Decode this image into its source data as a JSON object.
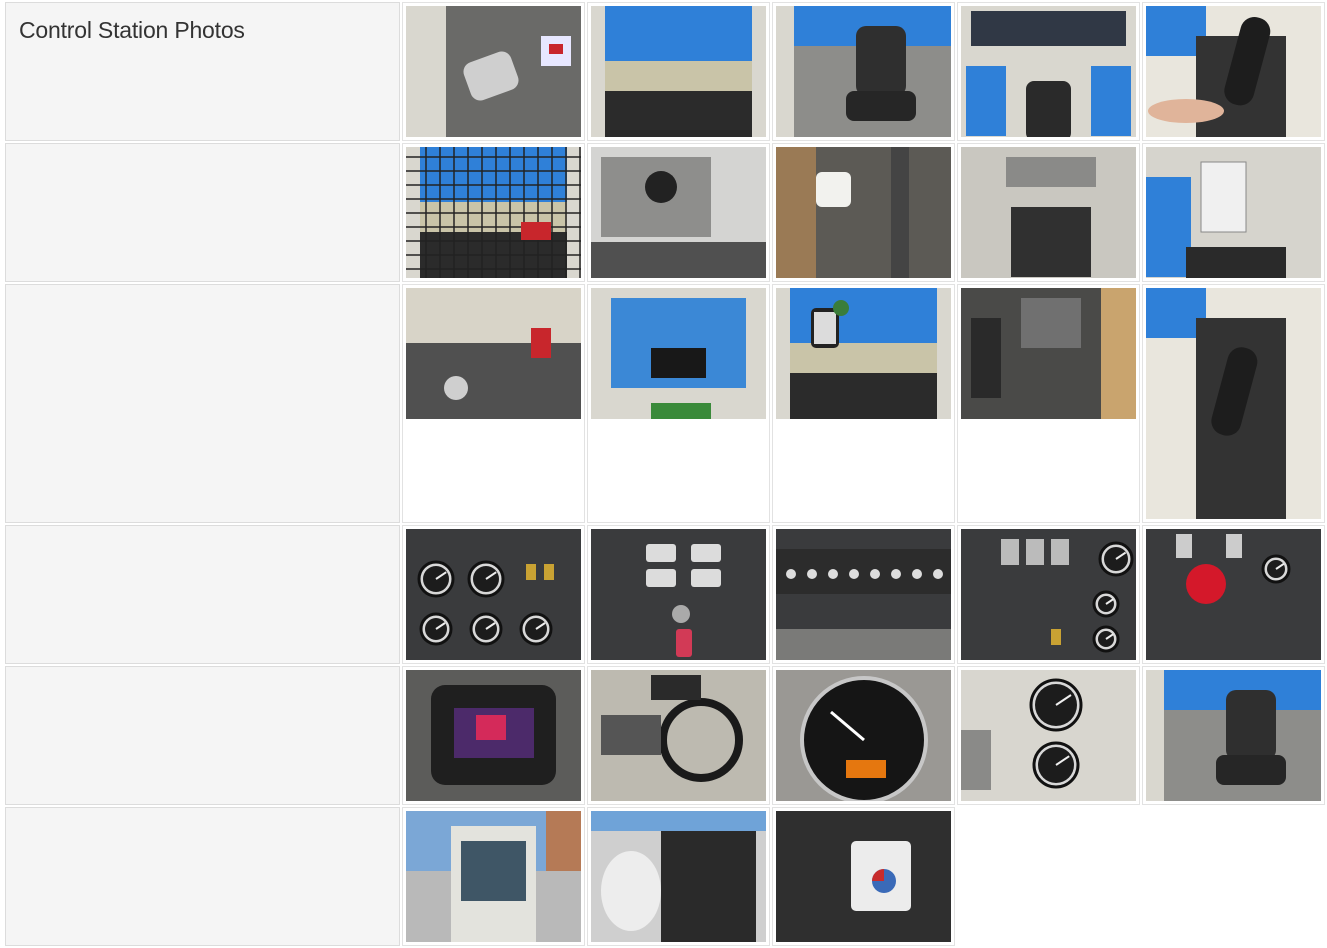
{
  "section": {
    "title": "Control Station Photos"
  },
  "rows": [
    {
      "tall": false,
      "photos": [
        {
          "alt": "cab floor with pedal",
          "scene": "floor"
        },
        {
          "alt": "operator cab window view",
          "scene": "window"
        },
        {
          "alt": "operator seat and controls",
          "scene": "seat"
        },
        {
          "alt": "cab rear window and seat",
          "scene": "rear"
        },
        {
          "alt": "joystick with hand",
          "scene": "joystick"
        }
      ]
    },
    {
      "tall": false,
      "photos": [
        {
          "alt": "cab window with guard",
          "scene": "guard"
        },
        {
          "alt": "heater vent panel",
          "scene": "vent"
        },
        {
          "alt": "fluid reservoir",
          "scene": "reservoir"
        },
        {
          "alt": "floor console",
          "scene": "console"
        },
        {
          "alt": "side panel with chart",
          "scene": "chart"
        }
      ]
    },
    {
      "tall": true,
      "photos": [
        {
          "alt": "overhead dashboard",
          "scene": "dash"
        },
        {
          "alt": "skylight roof window",
          "scene": "skylight"
        },
        {
          "alt": "mirror street view",
          "scene": "mirror"
        },
        {
          "alt": "pedals and panel",
          "scene": "pedals"
        },
        {
          "alt": "joystick closeup",
          "scene": "joystick2"
        }
      ]
    },
    {
      "tall": false,
      "photos": [
        {
          "alt": "gauge cluster",
          "scene": "gauges"
        },
        {
          "alt": "switch panel with key",
          "scene": "switches"
        },
        {
          "alt": "control decal panel",
          "scene": "decal"
        },
        {
          "alt": "switch and gauge panel",
          "scene": "panel2"
        },
        {
          "alt": "emergency stop panel",
          "scene": "estop"
        }
      ]
    },
    {
      "tall": false,
      "photos": [
        {
          "alt": "load moment display",
          "scene": "display"
        },
        {
          "alt": "steering wheel",
          "scene": "wheel"
        },
        {
          "alt": "tachometer",
          "scene": "tach"
        },
        {
          "alt": "two gauges",
          "scene": "twogauges"
        },
        {
          "alt": "operator seat",
          "scene": "seat2"
        }
      ]
    },
    {
      "tall": false,
      "photos": [
        {
          "alt": "cab exterior",
          "scene": "exterior"
        },
        {
          "alt": "winch drum",
          "scene": "winch"
        },
        {
          "alt": "control box",
          "scene": "box"
        }
      ]
    }
  ],
  "colors": {
    "sky": "#2f80d8",
    "cab": "#d9d7cf",
    "dark": "#2a2b2d",
    "panel": "#3a3b3d",
    "red": "#c8262c"
  }
}
